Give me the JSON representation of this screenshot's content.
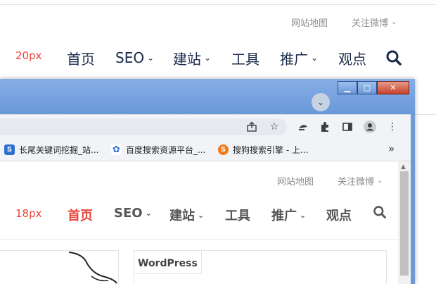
{
  "background_site": {
    "util_links": [
      "网站地图",
      "关注微博"
    ],
    "size_label": "20px",
    "nav": [
      "首页",
      "SEO",
      "建站",
      "工具",
      "推广",
      "观点"
    ]
  },
  "browser": {
    "bookmarks": [
      "长尾关键词挖掘_站...",
      "百度搜索资源平台_...",
      "搜狗搜索引擎 - 上..."
    ],
    "more_bookmarks": "»"
  },
  "foreground_site": {
    "util_links": [
      "网站地图",
      "关注微博"
    ],
    "size_label": "18px",
    "nav": [
      "首页",
      "SEO",
      "建站",
      "工具",
      "推广",
      "观点"
    ],
    "sidebar_tab": "WordPress"
  },
  "colors": {
    "accent_red": "#e8463d",
    "nav_dark": "#1a2a4a",
    "titlebar_blue": "#6a98d8"
  }
}
